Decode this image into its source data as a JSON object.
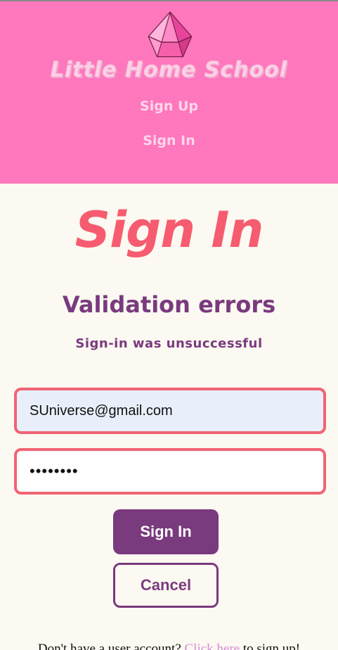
{
  "header": {
    "site_title": "Little Home School",
    "nav": {
      "sign_up": "Sign Up",
      "sign_in": "Sign In"
    },
    "logo": "pink-gem-icon"
  },
  "main": {
    "title": "Sign In",
    "errors_heading": "Validation errors",
    "errors_message": "Sign-in was unsuccessful"
  },
  "form": {
    "email_value": "SUniverse@gmail.com",
    "password_value": "••••••••",
    "submit_label": "Sign In",
    "cancel_label": "Cancel"
  },
  "footer": {
    "prefix": "Don't have a user account?",
    "link": "Click here",
    "suffix": "to sign up!"
  },
  "colors": {
    "header_bg": "#ff77bd",
    "page_bg": "#fbf9f1",
    "title_coral": "#f75b6f",
    "purple": "#7a3a7e",
    "error_border": "#f06473"
  }
}
